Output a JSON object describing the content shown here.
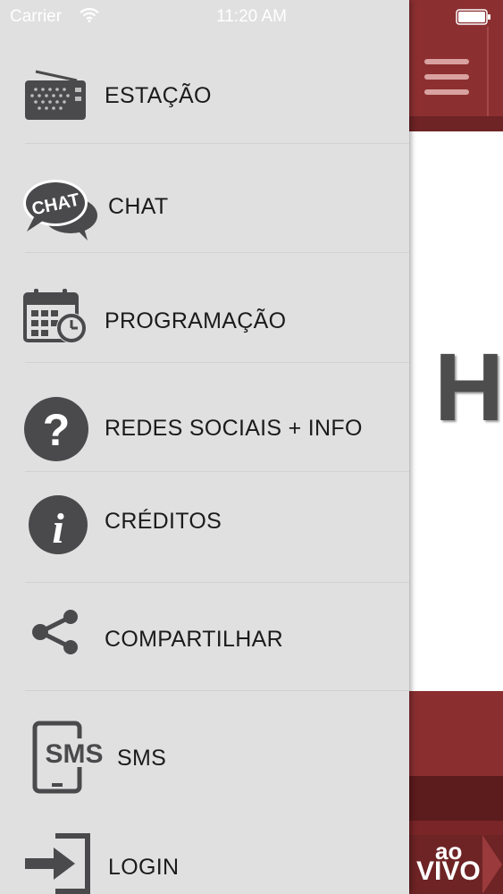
{
  "status_bar": {
    "carrier": "Carrier",
    "time": "11:20 AM",
    "wifi_icon": "wifi-icon",
    "battery_icon": "battery-icon"
  },
  "menu": {
    "items": [
      {
        "label": "ESTAÇÃO",
        "icon": "radio-icon"
      },
      {
        "label": "CHAT",
        "icon": "chat-bubble-icon",
        "icon_text": "CHAT"
      },
      {
        "label": "PROGRAMAÇÃO",
        "icon": "calendar-clock-icon"
      },
      {
        "label": "REDES SOCIAIS + INFO",
        "icon": "question-icon"
      },
      {
        "label": "CRÉDITOS",
        "icon": "info-icon"
      },
      {
        "label": "COMPARTILHAR",
        "icon": "share-icon"
      },
      {
        "label": "SMS",
        "icon": "sms-phone-icon",
        "icon_text": "SMS"
      },
      {
        "label": "LOGIN",
        "icon": "login-icon"
      }
    ]
  },
  "background_app": {
    "menu_icon": "hamburger-icon",
    "logo_letter": "H",
    "live_button": {
      "line1": "ao",
      "line2": "VIVO"
    },
    "colors": {
      "brand": "#8c2f31",
      "drawer": "#e1e0e1",
      "icon": "#4a4a4c"
    }
  }
}
